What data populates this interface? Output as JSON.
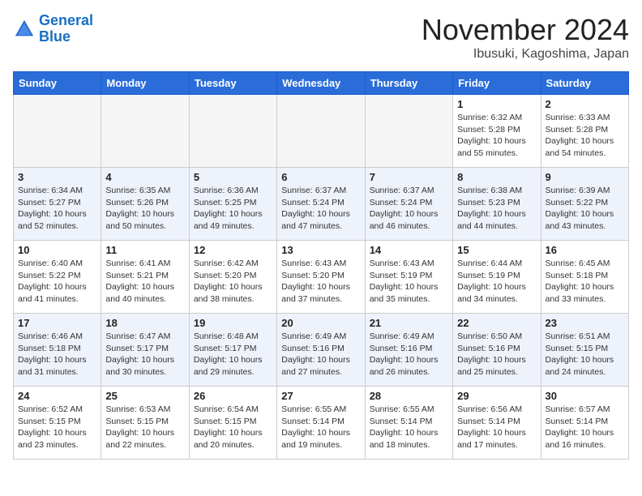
{
  "header": {
    "logo_line1": "General",
    "logo_line2": "Blue",
    "month_title": "November 2024",
    "location": "Ibusuki, Kagoshima, Japan"
  },
  "weekdays": [
    "Sunday",
    "Monday",
    "Tuesday",
    "Wednesday",
    "Thursday",
    "Friday",
    "Saturday"
  ],
  "weeks": [
    [
      {
        "day": "",
        "info": ""
      },
      {
        "day": "",
        "info": ""
      },
      {
        "day": "",
        "info": ""
      },
      {
        "day": "",
        "info": ""
      },
      {
        "day": "",
        "info": ""
      },
      {
        "day": "1",
        "info": "Sunrise: 6:32 AM\nSunset: 5:28 PM\nDaylight: 10 hours\nand 55 minutes."
      },
      {
        "day": "2",
        "info": "Sunrise: 6:33 AM\nSunset: 5:28 PM\nDaylight: 10 hours\nand 54 minutes."
      }
    ],
    [
      {
        "day": "3",
        "info": "Sunrise: 6:34 AM\nSunset: 5:27 PM\nDaylight: 10 hours\nand 52 minutes."
      },
      {
        "day": "4",
        "info": "Sunrise: 6:35 AM\nSunset: 5:26 PM\nDaylight: 10 hours\nand 50 minutes."
      },
      {
        "day": "5",
        "info": "Sunrise: 6:36 AM\nSunset: 5:25 PM\nDaylight: 10 hours\nand 49 minutes."
      },
      {
        "day": "6",
        "info": "Sunrise: 6:37 AM\nSunset: 5:24 PM\nDaylight: 10 hours\nand 47 minutes."
      },
      {
        "day": "7",
        "info": "Sunrise: 6:37 AM\nSunset: 5:24 PM\nDaylight: 10 hours\nand 46 minutes."
      },
      {
        "day": "8",
        "info": "Sunrise: 6:38 AM\nSunset: 5:23 PM\nDaylight: 10 hours\nand 44 minutes."
      },
      {
        "day": "9",
        "info": "Sunrise: 6:39 AM\nSunset: 5:22 PM\nDaylight: 10 hours\nand 43 minutes."
      }
    ],
    [
      {
        "day": "10",
        "info": "Sunrise: 6:40 AM\nSunset: 5:22 PM\nDaylight: 10 hours\nand 41 minutes."
      },
      {
        "day": "11",
        "info": "Sunrise: 6:41 AM\nSunset: 5:21 PM\nDaylight: 10 hours\nand 40 minutes."
      },
      {
        "day": "12",
        "info": "Sunrise: 6:42 AM\nSunset: 5:20 PM\nDaylight: 10 hours\nand 38 minutes."
      },
      {
        "day": "13",
        "info": "Sunrise: 6:43 AM\nSunset: 5:20 PM\nDaylight: 10 hours\nand 37 minutes."
      },
      {
        "day": "14",
        "info": "Sunrise: 6:43 AM\nSunset: 5:19 PM\nDaylight: 10 hours\nand 35 minutes."
      },
      {
        "day": "15",
        "info": "Sunrise: 6:44 AM\nSunset: 5:19 PM\nDaylight: 10 hours\nand 34 minutes."
      },
      {
        "day": "16",
        "info": "Sunrise: 6:45 AM\nSunset: 5:18 PM\nDaylight: 10 hours\nand 33 minutes."
      }
    ],
    [
      {
        "day": "17",
        "info": "Sunrise: 6:46 AM\nSunset: 5:18 PM\nDaylight: 10 hours\nand 31 minutes."
      },
      {
        "day": "18",
        "info": "Sunrise: 6:47 AM\nSunset: 5:17 PM\nDaylight: 10 hours\nand 30 minutes."
      },
      {
        "day": "19",
        "info": "Sunrise: 6:48 AM\nSunset: 5:17 PM\nDaylight: 10 hours\nand 29 minutes."
      },
      {
        "day": "20",
        "info": "Sunrise: 6:49 AM\nSunset: 5:16 PM\nDaylight: 10 hours\nand 27 minutes."
      },
      {
        "day": "21",
        "info": "Sunrise: 6:49 AM\nSunset: 5:16 PM\nDaylight: 10 hours\nand 26 minutes."
      },
      {
        "day": "22",
        "info": "Sunrise: 6:50 AM\nSunset: 5:16 PM\nDaylight: 10 hours\nand 25 minutes."
      },
      {
        "day": "23",
        "info": "Sunrise: 6:51 AM\nSunset: 5:15 PM\nDaylight: 10 hours\nand 24 minutes."
      }
    ],
    [
      {
        "day": "24",
        "info": "Sunrise: 6:52 AM\nSunset: 5:15 PM\nDaylight: 10 hours\nand 23 minutes."
      },
      {
        "day": "25",
        "info": "Sunrise: 6:53 AM\nSunset: 5:15 PM\nDaylight: 10 hours\nand 22 minutes."
      },
      {
        "day": "26",
        "info": "Sunrise: 6:54 AM\nSunset: 5:15 PM\nDaylight: 10 hours\nand 20 minutes."
      },
      {
        "day": "27",
        "info": "Sunrise: 6:55 AM\nSunset: 5:14 PM\nDaylight: 10 hours\nand 19 minutes."
      },
      {
        "day": "28",
        "info": "Sunrise: 6:55 AM\nSunset: 5:14 PM\nDaylight: 10 hours\nand 18 minutes."
      },
      {
        "day": "29",
        "info": "Sunrise: 6:56 AM\nSunset: 5:14 PM\nDaylight: 10 hours\nand 17 minutes."
      },
      {
        "day": "30",
        "info": "Sunrise: 6:57 AM\nSunset: 5:14 PM\nDaylight: 10 hours\nand 16 minutes."
      }
    ]
  ]
}
